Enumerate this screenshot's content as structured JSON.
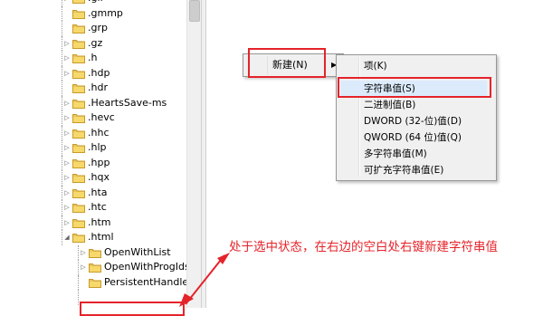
{
  "tree": {
    "items": [
      {
        "label": ".gif",
        "state": "collapsed",
        "level": 1
      },
      {
        "label": ".gmmp",
        "state": "leaf",
        "level": 1
      },
      {
        "label": ".grp",
        "state": "leaf",
        "level": 1
      },
      {
        "label": ".gz",
        "state": "collapsed",
        "level": 1
      },
      {
        "label": ".h",
        "state": "collapsed",
        "level": 1
      },
      {
        "label": ".hdp",
        "state": "collapsed",
        "level": 1
      },
      {
        "label": ".hdr",
        "state": "leaf",
        "level": 1
      },
      {
        "label": ".HeartsSave-ms",
        "state": "collapsed",
        "level": 1
      },
      {
        "label": ".hevc",
        "state": "collapsed",
        "level": 1
      },
      {
        "label": ".hhc",
        "state": "collapsed",
        "level": 1
      },
      {
        "label": ".hlp",
        "state": "collapsed",
        "level": 1
      },
      {
        "label": ".hpp",
        "state": "collapsed",
        "level": 1
      },
      {
        "label": ".hqx",
        "state": "collapsed",
        "level": 1
      },
      {
        "label": ".hta",
        "state": "collapsed",
        "level": 1
      },
      {
        "label": ".htc",
        "state": "collapsed",
        "level": 1
      },
      {
        "label": ".htm",
        "state": "collapsed",
        "level": 1
      },
      {
        "label": ".html",
        "state": "expanded",
        "level": 1
      },
      {
        "label": "OpenWithList",
        "state": "collapsed",
        "level": 2
      },
      {
        "label": "OpenWithProgIds",
        "state": "collapsed",
        "level": 2
      },
      {
        "label": "PersistentHandler",
        "state": "leaf",
        "level": 2
      },
      {
        "label": "",
        "state": "selected",
        "level": 2
      }
    ]
  },
  "context_menu": {
    "new_label": "新建(N)",
    "submenu_arrow": "▶",
    "submenu": [
      "项(K)",
      "字符串值(S)",
      "二进制值(B)",
      "DWORD (32-位)值(D)",
      "QWORD (64 位)值(Q)",
      "多字符串值(M)",
      "可扩充字符串值(E)"
    ]
  },
  "annotation": {
    "text": "处于选中状态，在右边的空白处右键新建字符串值"
  },
  "colors": {
    "highlight_red": "#e5232a",
    "menu_bg": "#f0f0f0",
    "menu_selected": "#dcebfc",
    "folder": "#e8c65a"
  },
  "icons": {
    "folder": "folder-icon",
    "expander_collapsed": "▷",
    "expander_expanded": "◢"
  }
}
